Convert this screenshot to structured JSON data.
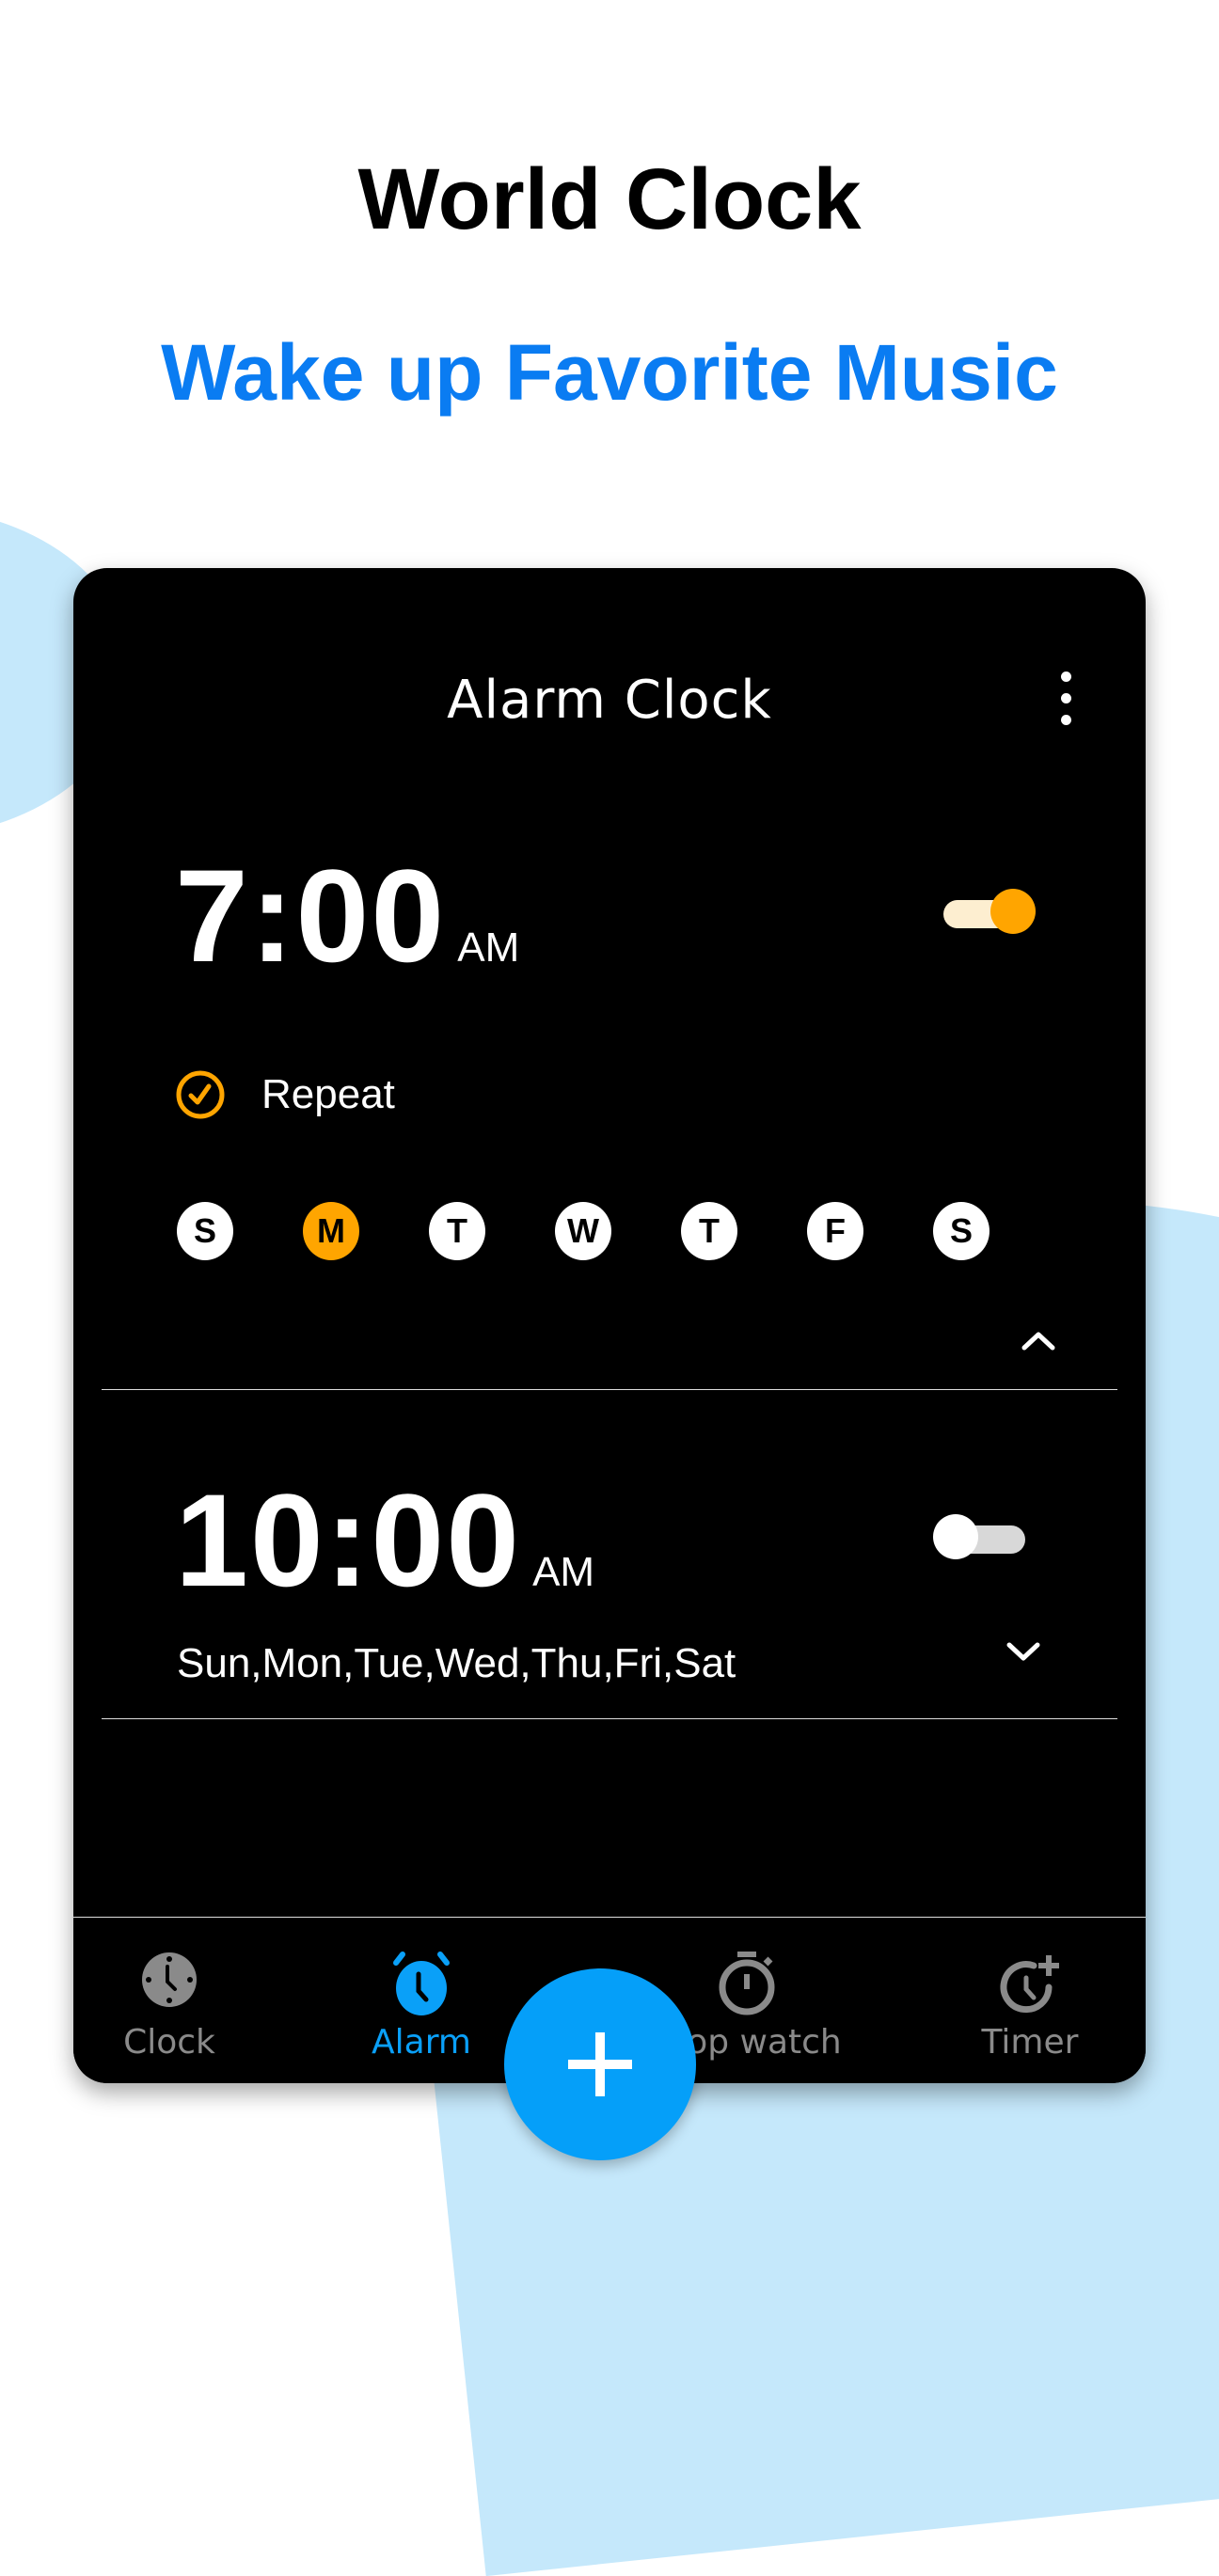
{
  "promo": {
    "headline": "World Clock",
    "subheadline": "Wake up Favorite Music"
  },
  "app": {
    "title": "Alarm Clock",
    "more_menu_icon": "more-vertical-icon"
  },
  "alarms": [
    {
      "time": "7:00",
      "period": "AM",
      "enabled": true,
      "expanded": true,
      "repeat_label": "Repeat",
      "repeat_checked": true,
      "days": [
        {
          "letter": "S",
          "selected": false
        },
        {
          "letter": "M",
          "selected": true
        },
        {
          "letter": "T",
          "selected": false
        },
        {
          "letter": "W",
          "selected": false
        },
        {
          "letter": "T",
          "selected": false
        },
        {
          "letter": "F",
          "selected": false
        },
        {
          "letter": "S",
          "selected": false
        }
      ]
    },
    {
      "time": "10:00",
      "period": "AM",
      "enabled": false,
      "expanded": false,
      "days_summary": "Sun,Mon,Tue,Wed,Thu,Fri,Sat"
    }
  ],
  "bottom_nav": {
    "items": [
      {
        "label": "Clock",
        "icon": "clock-icon",
        "active": false
      },
      {
        "label": "Alarm",
        "icon": "alarm-icon",
        "active": true
      },
      {
        "label": "Stop watch",
        "visible_label": "p watch",
        "icon": "stopwatch-icon",
        "active": false
      },
      {
        "label": "Timer",
        "icon": "timer-icon",
        "active": false
      }
    ]
  },
  "fab": {
    "icon": "plus-icon",
    "label": "Add alarm"
  },
  "colors": {
    "accent_orange": "#ffa500",
    "accent_blue": "#059ff9",
    "headline_blue": "#0a7cf2",
    "background_blob": "#c5e8fb",
    "inactive_gray": "#8a8a8a"
  }
}
